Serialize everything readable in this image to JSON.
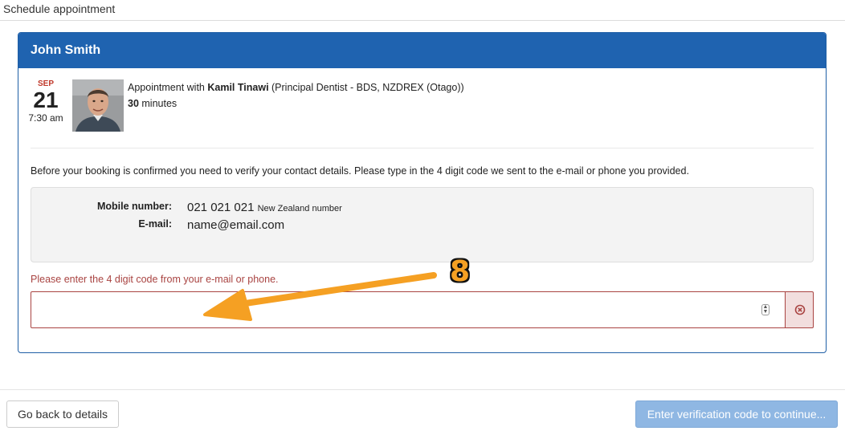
{
  "page": {
    "title": "Schedule appointment"
  },
  "panel": {
    "heading": "John Smith"
  },
  "appointment": {
    "month": "SEP",
    "day": "21",
    "time": "7:30 am",
    "prefix": "Appointment with ",
    "provider": "Kamil Tinawi",
    "provider_detail": " (Principal Dentist - BDS, NZDREX (Otago))",
    "duration_value": "30",
    "duration_unit": " minutes"
  },
  "verification": {
    "instructions": "Before your booking is confirmed you need to verify your contact details. Please type in the 4 digit code we sent to the e-mail or phone you provided.",
    "mobile_label": "Mobile number:",
    "mobile_value": "021 021 021",
    "mobile_note": "New Zealand number",
    "email_label": "E-mail:",
    "email_value": "name@email.com",
    "error_message": "Please enter the 4 digit code from your e-mail or phone.",
    "code_value": ""
  },
  "footer": {
    "back_label": "Go back to details",
    "continue_label": "Enter verification code to continue..."
  },
  "annotation": {
    "number": "8",
    "color": "#f5a023"
  },
  "colors": {
    "header_blue": "#1f63b0",
    "error_red": "#a94442",
    "error_bg": "#f2dede",
    "continue_disabled": "#8fb7e3"
  }
}
